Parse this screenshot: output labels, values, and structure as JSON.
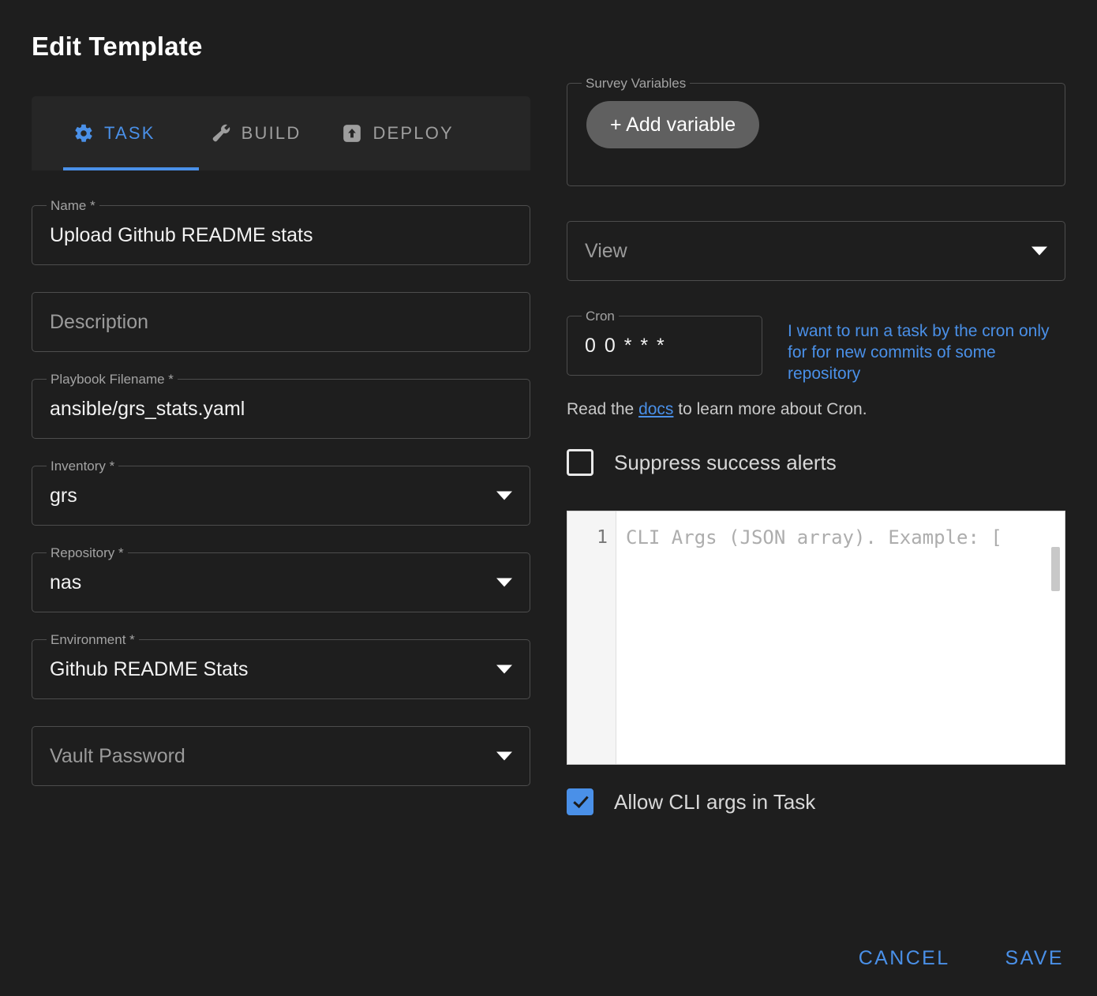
{
  "page": {
    "title": "Edit Template"
  },
  "tabs": [
    {
      "label": "TASK",
      "icon": "gear-icon",
      "active": true
    },
    {
      "label": "BUILD",
      "icon": "wrench-icon",
      "active": false
    },
    {
      "label": "DEPLOY",
      "icon": "upload-icon",
      "active": false
    }
  ],
  "form": {
    "name": {
      "legend": "Name *",
      "value": "Upload Github README stats"
    },
    "description": {
      "placeholder": "Description",
      "value": ""
    },
    "playbook": {
      "legend": "Playbook Filename *",
      "value": "ansible/grs_stats.yaml"
    },
    "inventory": {
      "legend": "Inventory *",
      "value": "grs"
    },
    "repository": {
      "legend": "Repository *",
      "value": "nas"
    },
    "environment": {
      "legend": "Environment *",
      "value": "Github README Stats"
    },
    "vault": {
      "placeholder": "Vault Password",
      "value": ""
    }
  },
  "survey": {
    "legend": "Survey Variables",
    "add_label": "+ Add variable"
  },
  "view": {
    "placeholder": "View",
    "value": ""
  },
  "cron": {
    "legend": "Cron",
    "value": "0 0 * * *",
    "hint_link": "I want to run a task by the cron only for for new commits of some repository",
    "docs_prefix": "Read the ",
    "docs_link": "docs",
    "docs_suffix": " to learn more about Cron."
  },
  "options": {
    "suppress_success_alerts": {
      "label": "Suppress success alerts",
      "checked": false
    },
    "allow_cli_args": {
      "label": "Allow CLI args in Task",
      "checked": true
    }
  },
  "cli_editor": {
    "line_number": "1",
    "placeholder": "CLI Args (JSON array). Example: ["
  },
  "footer": {
    "cancel_label": "CANCEL",
    "save_label": "SAVE"
  },
  "colors": {
    "accent": "#4a90e8",
    "background": "#1e1e1e",
    "surface": "#262626",
    "border": "#4d4d4d",
    "button_grey": "#606060"
  }
}
